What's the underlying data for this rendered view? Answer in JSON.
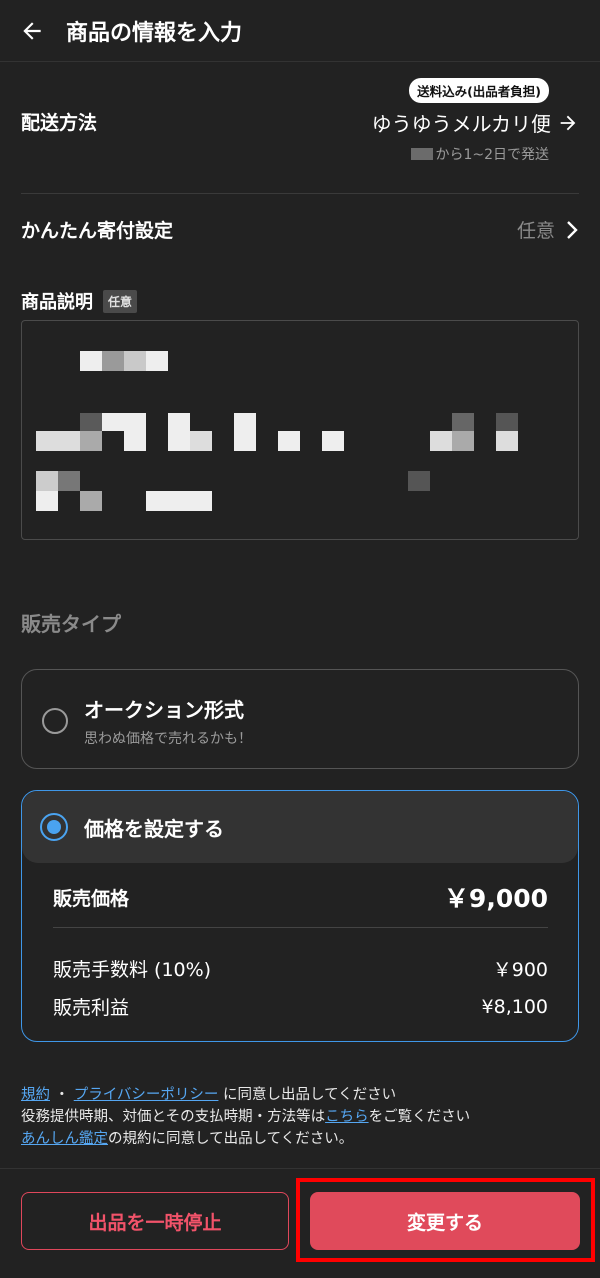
{
  "header": {
    "title": "商品の情報を入力",
    "back_icon": "arrow-left-icon"
  },
  "shipping": {
    "label": "配送方法",
    "badge": "送料込み(出品者負担)",
    "method": "ゆうゆうメルカリ便",
    "note": "から1~2日で発送"
  },
  "donation": {
    "label": "かんたん寄付設定",
    "value": "任意"
  },
  "description": {
    "label": "商品説明",
    "tag": "任意"
  },
  "sales_type": {
    "label": "販売タイプ",
    "auction": {
      "title": "オークション形式",
      "subtitle": "思わぬ価格で売れるかも！",
      "selected": false
    },
    "fixed": {
      "title": "価格を設定する",
      "selected": true,
      "price_label": "販売価格",
      "price_value": "￥9,000",
      "fee_label": "販売手数料 (10%)",
      "fee_value": "￥900",
      "profit_label": "販売利益",
      "profit_value": "¥8,100"
    }
  },
  "terms": {
    "link_terms": "規約",
    "sep": "・",
    "link_privacy": "プライバシーポリシー",
    "line1_rest": "に同意し出品してください",
    "line2_pre": "役務提供時期、対価とその支払時期・方法等は",
    "link_here": "こちら",
    "line2_post": "をご覧ください",
    "link_anshin": "あんしん鑑定",
    "line3_rest": "の規約に同意して出品してください。"
  },
  "footer": {
    "pause_label": "出品を一時停止",
    "change_label": "変更する"
  },
  "colors": {
    "background": "#222222",
    "accent_red": "#e04a5b",
    "accent_blue": "#3f97e8",
    "link": "#56a7f2"
  }
}
